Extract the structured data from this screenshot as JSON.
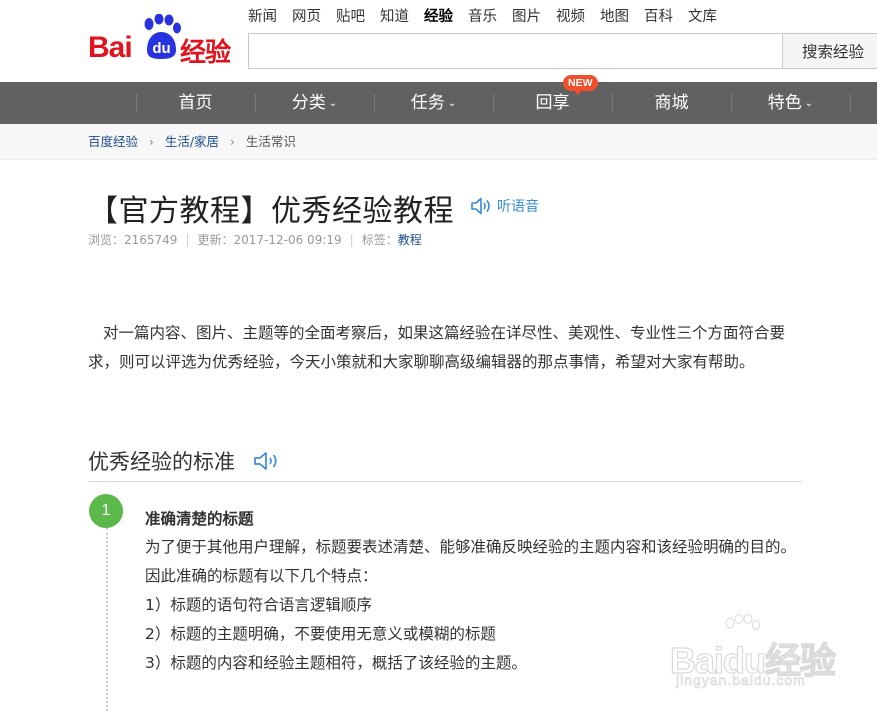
{
  "brand": {
    "logo_text": "Bai",
    "logo_du": "du",
    "logo_suffix": "经验"
  },
  "topnav": [
    {
      "label": "新闻",
      "active": false
    },
    {
      "label": "网页",
      "active": false
    },
    {
      "label": "贴吧",
      "active": false
    },
    {
      "label": "知道",
      "active": false
    },
    {
      "label": "经验",
      "active": true
    },
    {
      "label": "音乐",
      "active": false
    },
    {
      "label": "图片",
      "active": false
    },
    {
      "label": "视频",
      "active": false
    },
    {
      "label": "地图",
      "active": false
    },
    {
      "label": "百科",
      "active": false
    },
    {
      "label": "文库",
      "active": false
    }
  ],
  "search": {
    "value": "",
    "button_label": "搜索经验"
  },
  "mainnav": {
    "items": [
      {
        "label": "首页",
        "has_caret": false
      },
      {
        "label": "分类",
        "has_caret": true
      },
      {
        "label": "任务",
        "has_caret": true
      },
      {
        "label": "回享",
        "has_caret": false
      },
      {
        "label": "商城",
        "has_caret": false
      },
      {
        "label": "特色",
        "has_caret": true
      }
    ],
    "new_badge": "NEW"
  },
  "breadcrumb": {
    "items": [
      "百度经验",
      "生活/家居",
      "生活常识"
    ]
  },
  "article": {
    "title": "【官方教程】优秀经验教程",
    "listen_label": "听语音",
    "views": "浏览：2165749",
    "updated": "更新：2017-12-06 09:19",
    "tag_label": "标签：",
    "tag": "教程",
    "intro": "对一篇内容、图片、主题等的全面考察后，如果这篇经验在详尽性、美观性、专业性三个方面符合要求，则可以评选为优秀经验，今天小策就和大家聊聊高级编辑器的那点事情，希望对大家有帮助。"
  },
  "section": {
    "title": "优秀经验的标准",
    "step": {
      "number": "1",
      "title": "准确清楚的标题",
      "lines": [
        "为了便于其他用户理解，标题要表述清楚、能够准确反映经验的主题内容和该经验明确的目的。因此准确的标题有以下几个特点：",
        "1）标题的语句符合语言逻辑顺序",
        "2）标题的主题明确，不要使用无意义或模糊的标题",
        "3）标题的内容和经验主题相符，概括了该经验的主题。"
      ]
    }
  },
  "watermark": {
    "text": "Baidu经验",
    "url": "jingyan.baidu.com"
  },
  "colors": {
    "brand_red": "#e0141e",
    "nav_bg": "#616161",
    "link_blue": "#1e4c8f",
    "step_green": "#5cb84a",
    "badge": "#f2502d"
  }
}
